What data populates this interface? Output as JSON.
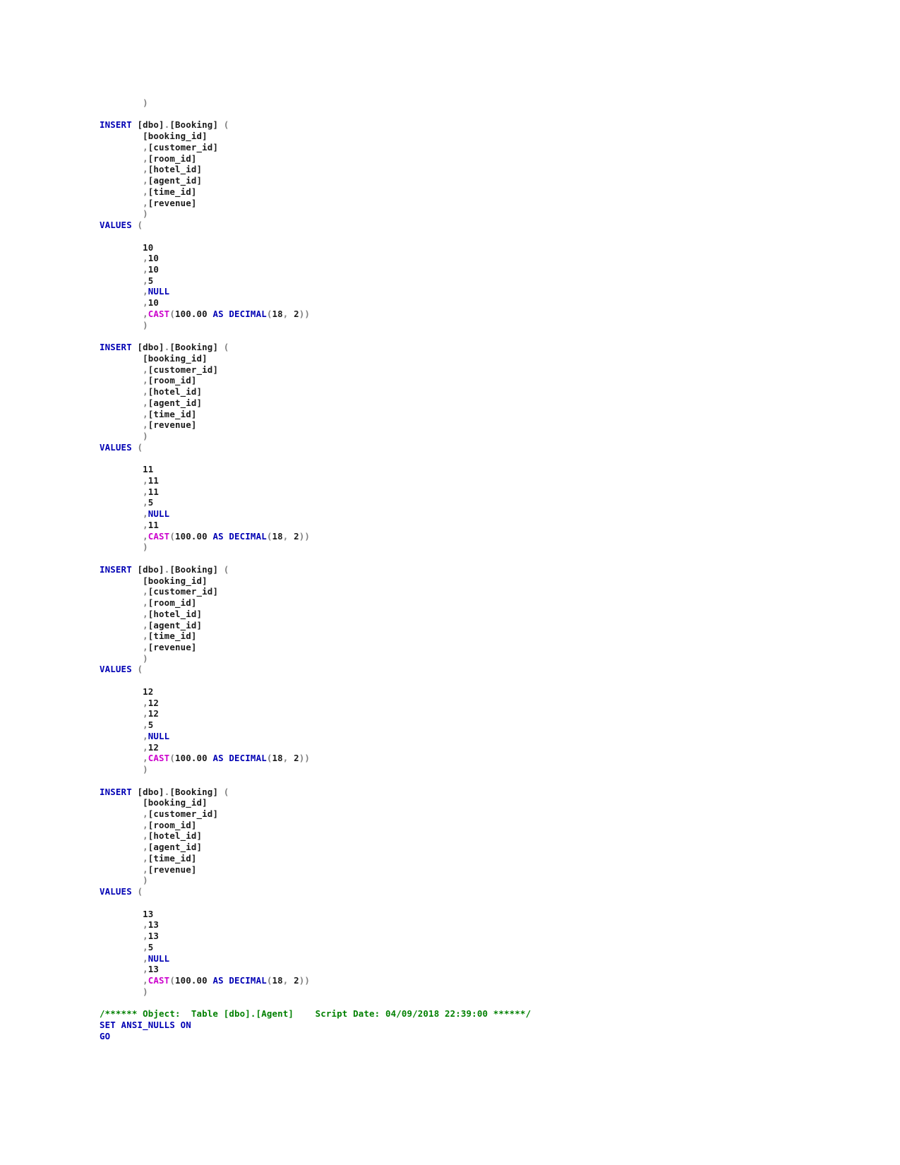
{
  "document": {
    "kind": "sql-script-listing",
    "language": "T-SQL",
    "colors": {
      "background": "#ffffff",
      "keyword": "#0000b4",
      "identifier": "#1a1a1a",
      "number": "#1a1a1a",
      "punctuation": "#808080",
      "function": "#cc00cc",
      "comment": "#008000"
    }
  },
  "code": {
    "top_fragment": {
      "indent": "        ",
      "close_paren": ")"
    },
    "keywords": {
      "insert": "INSERT",
      "values": "VALUES",
      "null": "NULL",
      "as": "AS",
      "decimal": "DECIMAL",
      "cast": "CAST",
      "set": "SET",
      "ansi_nulls_on": "ANSI_NULLS ON",
      "go": "GO"
    },
    "table": {
      "schema": "[dbo]",
      "name": "[Booking]",
      "dot": ".",
      "open_paren": "(",
      "close_paren": ")"
    },
    "columns": [
      "[booking_id]",
      "[customer_id]",
      "[room_id]",
      "[hotel_id]",
      "[agent_id]",
      "[time_id]",
      "[revenue]"
    ],
    "revenue_literal": {
      "prefix": "CAST",
      "open": "(",
      "amount": "100.00",
      "as": "AS",
      "type": "DECIMAL",
      "type_open": "(",
      "precision": "18",
      "comma": ",",
      "scale": "2",
      "close": "))"
    },
    "comma": ",",
    "blocks": [
      {
        "booking_id": "10",
        "customer_id": "10",
        "room_id": "10",
        "hotel_id": "5",
        "agent_id": "NULL",
        "time_id": "10",
        "revenue": "CAST(100.00 AS DECIMAL(18, 2))"
      },
      {
        "booking_id": "11",
        "customer_id": "11",
        "room_id": "11",
        "hotel_id": "5",
        "agent_id": "NULL",
        "time_id": "11",
        "revenue": "CAST(100.00 AS DECIMAL(18, 2))"
      },
      {
        "booking_id": "12",
        "customer_id": "12",
        "room_id": "12",
        "hotel_id": "5",
        "agent_id": "NULL",
        "time_id": "12",
        "revenue": "CAST(100.00 AS DECIMAL(18, 2))"
      },
      {
        "booking_id": "13",
        "customer_id": "13",
        "room_id": "13",
        "hotel_id": "5",
        "agent_id": "NULL",
        "time_id": "13",
        "revenue": "CAST(100.00 AS DECIMAL(18, 2))"
      }
    ],
    "footer": {
      "comment": "/****** Object:  Table [dbo].[Agent]    Script Date: 04/09/2018 22:39:00 ******/",
      "comment_open": "/****** Object:  Table ",
      "comment_table": "[dbo].[Agent]",
      "comment_middle": "    Script Date: ",
      "comment_date": "04/09/2018 22:39:00",
      "comment_close": " ******/",
      "set_statement": "SET ANSI_NULLS ON",
      "go_statement": "GO"
    }
  }
}
